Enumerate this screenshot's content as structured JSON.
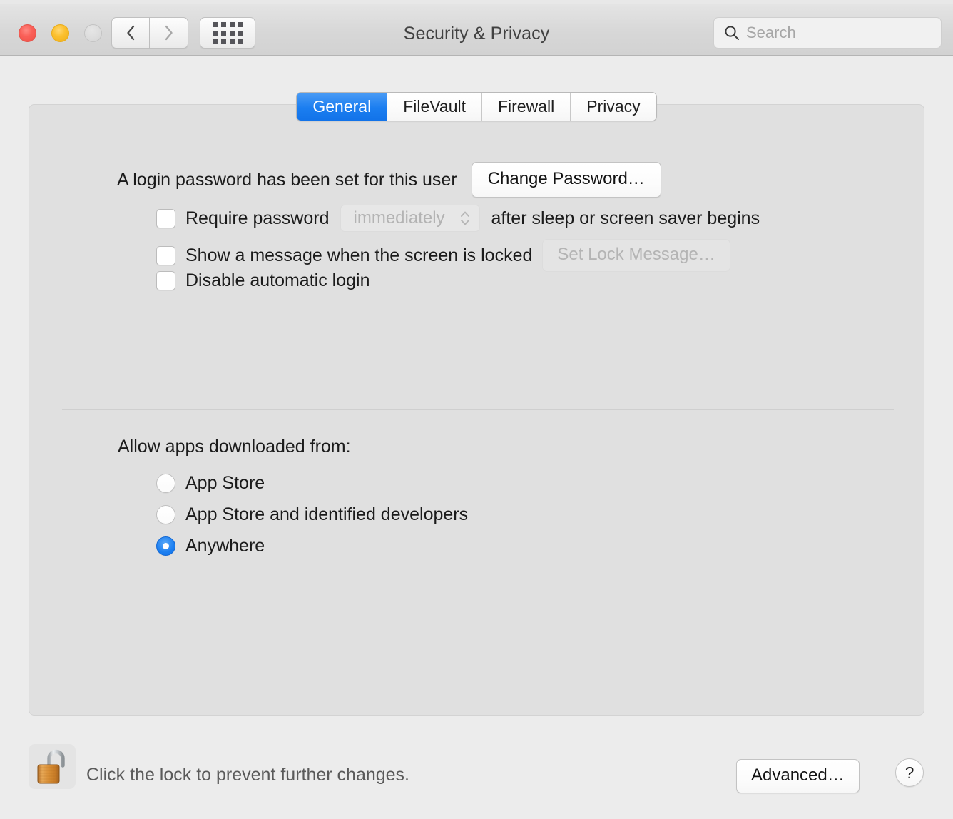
{
  "window": {
    "title": "Security & Privacy",
    "traffic_lights": {
      "close_label": "Close",
      "minimize_label": "Minimize",
      "zoom_label": "Zoom",
      "close_color": "#fa6058",
      "minimize_color": "#fcc02e",
      "zoom_color": "#dcdcdc"
    },
    "toolbar": {
      "back_label": "Back",
      "forward_label": "Forward",
      "show_all_label": "Show All"
    },
    "search": {
      "placeholder": "Search",
      "value": ""
    }
  },
  "tabs": [
    {
      "label": "General",
      "active": true
    },
    {
      "label": "FileVault",
      "active": false
    },
    {
      "label": "Firewall",
      "active": false
    },
    {
      "label": "Privacy",
      "active": false
    }
  ],
  "general": {
    "login_password_text": "A login password has been set for this user",
    "change_password_label": "Change Password…",
    "require_password": {
      "checked": false,
      "label": "Require password",
      "popup_value": "immediately",
      "popup_enabled": false,
      "suffix": "after sleep or screen saver begins"
    },
    "show_lock_message": {
      "checked": false,
      "label": "Show a message when the screen is locked",
      "button_label": "Set Lock Message…",
      "button_enabled": false
    },
    "disable_auto_login": {
      "checked": false,
      "label": "Disable automatic login"
    },
    "allow_apps": {
      "title": "Allow apps downloaded from:",
      "options": [
        {
          "label": "App Store",
          "selected": false
        },
        {
          "label": "App Store and identified developers",
          "selected": false
        },
        {
          "label": "Anywhere",
          "selected": true
        }
      ]
    }
  },
  "footer": {
    "lock_icon_state": "unlocked",
    "lock_message": "Click the lock to prevent further changes.",
    "advanced_label": "Advanced…",
    "help_label": "?"
  },
  "theme": {
    "accent": "#1b7ef0",
    "window_bg": "#ececec",
    "panel_bg": "#e0e0e0",
    "text": "#1b1b1b",
    "muted_text": "#b3b3b3"
  }
}
